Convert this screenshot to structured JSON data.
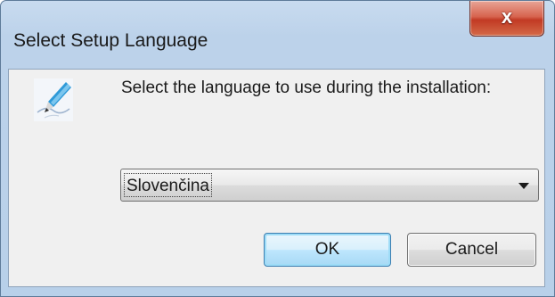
{
  "window": {
    "title": "Select Setup Language",
    "close_glyph": "x"
  },
  "dialog": {
    "icon": "setup-pen-icon",
    "prompt": "Select the language to use during the installation:",
    "language_select": {
      "selected": "Slovenčina"
    },
    "ok_label": "OK",
    "cancel_label": "Cancel"
  }
}
